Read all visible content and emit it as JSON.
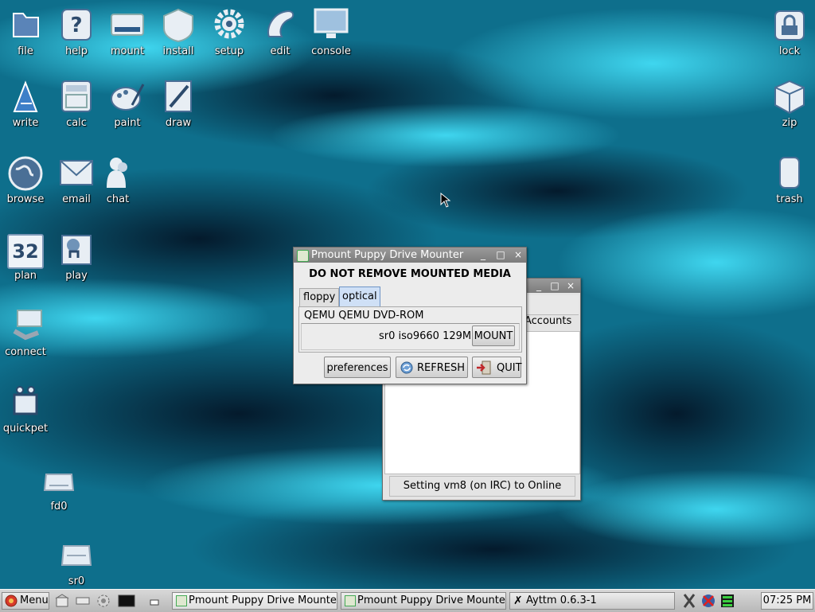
{
  "desktop_icons": {
    "file": "file",
    "help": "help",
    "mount": "mount",
    "install": "install",
    "setup": "setup",
    "edit": "edit",
    "console": "console",
    "lock": "lock",
    "write": "write",
    "calc": "calc",
    "paint": "paint",
    "draw": "draw",
    "zip": "zip",
    "browse": "browse",
    "email": "email",
    "chat": "chat",
    "trash": "trash",
    "plan": "plan",
    "plan_day": "32",
    "play": "play",
    "connect": "connect",
    "quickpet": "quickpet",
    "fd0": "fd0",
    "sr0": "sr0"
  },
  "pmount": {
    "title": "Pmount Puppy Drive Mounter",
    "warning": "DO NOT REMOVE MOUNTED MEDIA",
    "tabs": [
      "floppy",
      "optical"
    ],
    "active_tab": "optical",
    "drive_name": "QEMU QEMU DVD-ROM",
    "drive_info": "sr0 iso9660 129M",
    "mount_label": "MOUNT",
    "preferences_label": "preferences",
    "refresh_label": "REFRESH",
    "quit_label": "QUIT"
  },
  "ayttm": {
    "accounts_label": "Accounts",
    "status": "Setting vm8 (on IRC) to Online"
  },
  "taskbar": {
    "menu_label": "Menu",
    "tasks": [
      "Pmount Puppy Drive Mounter",
      "Pmount Puppy Drive Mounter",
      "Ayttm 0.6.3-1"
    ],
    "clock": "07:25 PM"
  },
  "colors": {
    "desktop_dark": "#02101c",
    "desktop_cyan": "#19b8d6",
    "active_tab": "#cfe0f6",
    "taskbar": "#c8c8c8"
  }
}
